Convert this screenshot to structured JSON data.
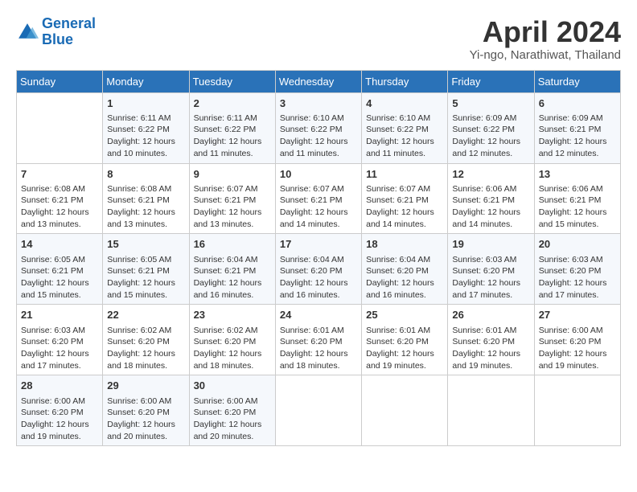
{
  "header": {
    "logo_line1": "General",
    "logo_line2": "Blue",
    "month": "April 2024",
    "location": "Yi-ngo, Narathiwat, Thailand"
  },
  "weekdays": [
    "Sunday",
    "Monday",
    "Tuesday",
    "Wednesday",
    "Thursday",
    "Friday",
    "Saturday"
  ],
  "weeks": [
    [
      {
        "day": "",
        "info": ""
      },
      {
        "day": "1",
        "info": "Sunrise: 6:11 AM\nSunset: 6:22 PM\nDaylight: 12 hours\nand 10 minutes."
      },
      {
        "day": "2",
        "info": "Sunrise: 6:11 AM\nSunset: 6:22 PM\nDaylight: 12 hours\nand 11 minutes."
      },
      {
        "day": "3",
        "info": "Sunrise: 6:10 AM\nSunset: 6:22 PM\nDaylight: 12 hours\nand 11 minutes."
      },
      {
        "day": "4",
        "info": "Sunrise: 6:10 AM\nSunset: 6:22 PM\nDaylight: 12 hours\nand 11 minutes."
      },
      {
        "day": "5",
        "info": "Sunrise: 6:09 AM\nSunset: 6:22 PM\nDaylight: 12 hours\nand 12 minutes."
      },
      {
        "day": "6",
        "info": "Sunrise: 6:09 AM\nSunset: 6:21 PM\nDaylight: 12 hours\nand 12 minutes."
      }
    ],
    [
      {
        "day": "7",
        "info": "Sunrise: 6:08 AM\nSunset: 6:21 PM\nDaylight: 12 hours\nand 13 minutes."
      },
      {
        "day": "8",
        "info": "Sunrise: 6:08 AM\nSunset: 6:21 PM\nDaylight: 12 hours\nand 13 minutes."
      },
      {
        "day": "9",
        "info": "Sunrise: 6:07 AM\nSunset: 6:21 PM\nDaylight: 12 hours\nand 13 minutes."
      },
      {
        "day": "10",
        "info": "Sunrise: 6:07 AM\nSunset: 6:21 PM\nDaylight: 12 hours\nand 14 minutes."
      },
      {
        "day": "11",
        "info": "Sunrise: 6:07 AM\nSunset: 6:21 PM\nDaylight: 12 hours\nand 14 minutes."
      },
      {
        "day": "12",
        "info": "Sunrise: 6:06 AM\nSunset: 6:21 PM\nDaylight: 12 hours\nand 14 minutes."
      },
      {
        "day": "13",
        "info": "Sunrise: 6:06 AM\nSunset: 6:21 PM\nDaylight: 12 hours\nand 15 minutes."
      }
    ],
    [
      {
        "day": "14",
        "info": "Sunrise: 6:05 AM\nSunset: 6:21 PM\nDaylight: 12 hours\nand 15 minutes."
      },
      {
        "day": "15",
        "info": "Sunrise: 6:05 AM\nSunset: 6:21 PM\nDaylight: 12 hours\nand 15 minutes."
      },
      {
        "day": "16",
        "info": "Sunrise: 6:04 AM\nSunset: 6:21 PM\nDaylight: 12 hours\nand 16 minutes."
      },
      {
        "day": "17",
        "info": "Sunrise: 6:04 AM\nSunset: 6:20 PM\nDaylight: 12 hours\nand 16 minutes."
      },
      {
        "day": "18",
        "info": "Sunrise: 6:04 AM\nSunset: 6:20 PM\nDaylight: 12 hours\nand 16 minutes."
      },
      {
        "day": "19",
        "info": "Sunrise: 6:03 AM\nSunset: 6:20 PM\nDaylight: 12 hours\nand 17 minutes."
      },
      {
        "day": "20",
        "info": "Sunrise: 6:03 AM\nSunset: 6:20 PM\nDaylight: 12 hours\nand 17 minutes."
      }
    ],
    [
      {
        "day": "21",
        "info": "Sunrise: 6:03 AM\nSunset: 6:20 PM\nDaylight: 12 hours\nand 17 minutes."
      },
      {
        "day": "22",
        "info": "Sunrise: 6:02 AM\nSunset: 6:20 PM\nDaylight: 12 hours\nand 18 minutes."
      },
      {
        "day": "23",
        "info": "Sunrise: 6:02 AM\nSunset: 6:20 PM\nDaylight: 12 hours\nand 18 minutes."
      },
      {
        "day": "24",
        "info": "Sunrise: 6:01 AM\nSunset: 6:20 PM\nDaylight: 12 hours\nand 18 minutes."
      },
      {
        "day": "25",
        "info": "Sunrise: 6:01 AM\nSunset: 6:20 PM\nDaylight: 12 hours\nand 19 minutes."
      },
      {
        "day": "26",
        "info": "Sunrise: 6:01 AM\nSunset: 6:20 PM\nDaylight: 12 hours\nand 19 minutes."
      },
      {
        "day": "27",
        "info": "Sunrise: 6:00 AM\nSunset: 6:20 PM\nDaylight: 12 hours\nand 19 minutes."
      }
    ],
    [
      {
        "day": "28",
        "info": "Sunrise: 6:00 AM\nSunset: 6:20 PM\nDaylight: 12 hours\nand 19 minutes."
      },
      {
        "day": "29",
        "info": "Sunrise: 6:00 AM\nSunset: 6:20 PM\nDaylight: 12 hours\nand 20 minutes."
      },
      {
        "day": "30",
        "info": "Sunrise: 6:00 AM\nSunset: 6:20 PM\nDaylight: 12 hours\nand 20 minutes."
      },
      {
        "day": "",
        "info": ""
      },
      {
        "day": "",
        "info": ""
      },
      {
        "day": "",
        "info": ""
      },
      {
        "day": "",
        "info": ""
      }
    ]
  ]
}
